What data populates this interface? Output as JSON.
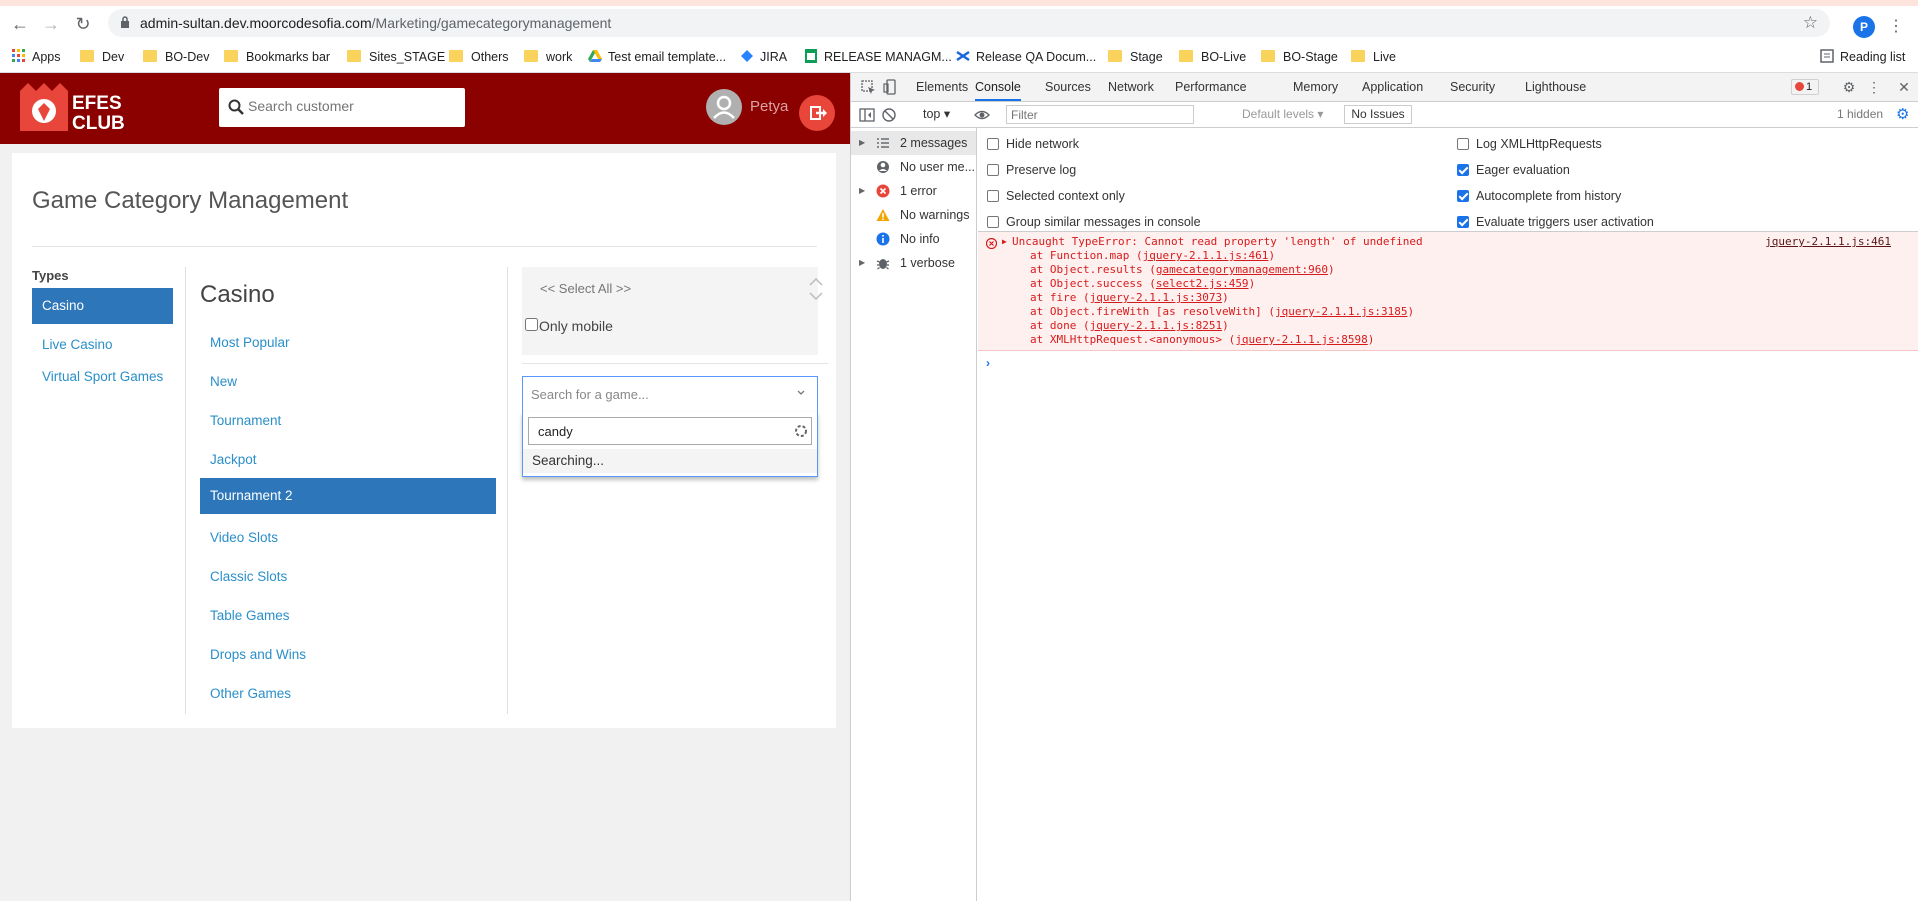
{
  "browser": {
    "url_host": "admin-sultan.dev.moorcodesofia.com",
    "url_path": "/Marketing/gamecategorymanagement",
    "profile_initial": "P",
    "bookmarks": [
      "Apps",
      "Dev",
      "BO-Dev",
      "Bookmarks bar",
      "Sites_STAGE",
      "Others",
      "work",
      "Test email template...",
      "JIRA",
      "RELEASE MANAGM...",
      "Release QA Docum...",
      "Stage",
      "BO-Live",
      "BO-Stage",
      "Live"
    ],
    "reading_list": "Reading list"
  },
  "app": {
    "logo_text_1": "EFES",
    "logo_text_2": "CLUB",
    "search_placeholder": "Search customer",
    "username": "Petya",
    "page_title": "Game Category Management",
    "types_label": "Types",
    "types": [
      "Casino",
      "Live Casino",
      "Virtual Sport Games"
    ],
    "active_type": "Casino",
    "category_heading": "Casino",
    "categories": [
      "Most Popular",
      "New",
      "Tournament",
      "Jackpot",
      "Tournament 2",
      "Video Slots",
      "Classic Slots",
      "Table Games",
      "Drops and Wins",
      "Other Games"
    ],
    "active_category": "Tournament 2",
    "select_all_label": "<< Select All >>",
    "only_mobile_label": "Only mobile",
    "only_mobile_checked": false,
    "game_select_placeholder": "Search for a game...",
    "game_search_value": "candy",
    "searching_text": "Searching...",
    "brand_color": "#8a0100",
    "active_color": "#2d76b9"
  },
  "devtools": {
    "tabs": [
      "Elements",
      "Console",
      "Sources",
      "Network",
      "Performance",
      "Memory",
      "Application",
      "Security",
      "Lighthouse"
    ],
    "active_tab": "Console",
    "error_count": "1",
    "context": "top",
    "filter_placeholder": "Filter",
    "levels": "Default levels",
    "issues": "No Issues",
    "hidden": "1 hidden",
    "sidebar": [
      "2 messages",
      "No user me...",
      "1 error",
      "No warnings",
      "No info",
      "1 verbose"
    ],
    "options_left": [
      "Hide network",
      "Preserve log",
      "Selected context only",
      "Group similar messages in console"
    ],
    "options_right": [
      "Log XMLHttpRequests",
      "Eager evaluation",
      "Autocomplete from history",
      "Evaluate triggers user activation"
    ],
    "options_right_checked": [
      false,
      true,
      true,
      true
    ],
    "error": {
      "message": "Uncaught TypeError: Cannot read property 'length' of undefined",
      "source": "jquery-2.1.1.js:461",
      "frames": [
        {
          "pre": "at Function.map (",
          "link": "jquery-2.1.1.js:461",
          "post": ")"
        },
        {
          "pre": "at Object.results (",
          "link": "gamecategorymanagement:960",
          "post": ")"
        },
        {
          "pre": "at Object.success (",
          "link": "select2.js:459",
          "post": ")"
        },
        {
          "pre": "at fire (",
          "link": "jquery-2.1.1.js:3073",
          "post": ")"
        },
        {
          "pre": "at Object.fireWith [as resolveWith] (",
          "link": "jquery-2.1.1.js:3185",
          "post": ")"
        },
        {
          "pre": "at done (",
          "link": "jquery-2.1.1.js:8251",
          "post": ")"
        },
        {
          "pre": "at XMLHttpRequest.<anonymous> (",
          "link": "jquery-2.1.1.js:8598",
          "post": ")"
        }
      ]
    }
  }
}
